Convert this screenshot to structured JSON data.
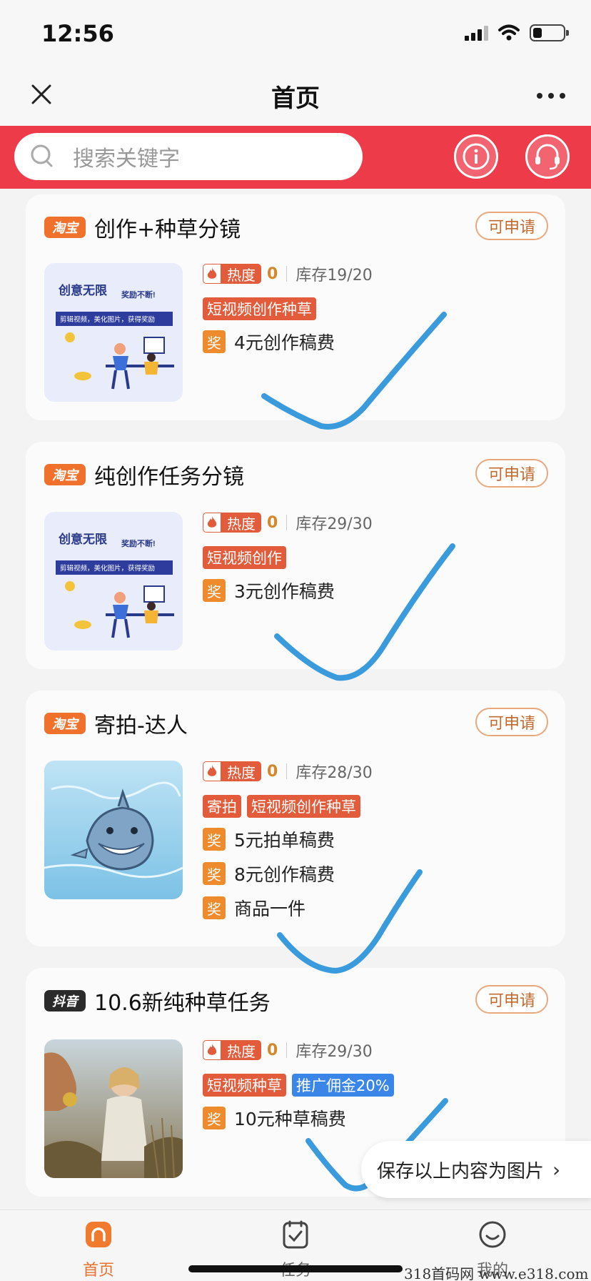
{
  "status_bar": {
    "time": "12:56"
  },
  "nav": {
    "title": "首页"
  },
  "search": {
    "placeholder": "搜索关键字"
  },
  "cards": [
    {
      "platform": "淘宝",
      "title": "创作+种草分镜",
      "apply": "可申请",
      "heat_label": "热度",
      "heat_value": "0",
      "stock": "库存19/20",
      "tags": [
        "短视频创作种草"
      ],
      "rewards": [
        {
          "badge": "奖",
          "text": "4元创作稿费"
        }
      ],
      "thumb": {
        "headline": "创意无限",
        "sub": "奖励不断!",
        "banner": "剪辑视频，美化图片，获得奖励"
      }
    },
    {
      "platform": "淘宝",
      "title": "纯创作任务分镜",
      "apply": "可申请",
      "heat_label": "热度",
      "heat_value": "0",
      "stock": "库存29/30",
      "tags": [
        "短视频创作"
      ],
      "rewards": [
        {
          "badge": "奖",
          "text": "3元创作稿费"
        }
      ],
      "thumb": {
        "headline": "创意无限",
        "sub": "奖励不断!",
        "banner": "剪辑视频，美化图片，获得奖励"
      }
    },
    {
      "platform": "淘宝",
      "title": "寄拍-达人",
      "apply": "可申请",
      "heat_label": "热度",
      "heat_value": "0",
      "stock": "库存28/30",
      "tags": [
        "寄拍",
        "短视频创作种草"
      ],
      "rewards": [
        {
          "badge": "奖",
          "text": "5元拍单稿费"
        },
        {
          "badge": "奖",
          "text": "8元创作稿费"
        },
        {
          "badge": "奖",
          "text": "商品一件"
        }
      ]
    },
    {
      "platform": "抖音",
      "title": "10.6新纯种草任务",
      "apply": "可申请",
      "heat_label": "热度",
      "heat_value": "0",
      "stock": "库存29/30",
      "tags": [
        "短视频种草",
        "推广佣金20%"
      ],
      "rewards": [
        {
          "badge": "奖",
          "text": "10元种草稿费"
        }
      ]
    }
  ],
  "save_pill": {
    "label": "保存以上内容为图片",
    "arrow": "›"
  },
  "tabs": [
    {
      "label": "首页",
      "icon": "home-icon",
      "active": true
    },
    {
      "label": "任务",
      "icon": "task-icon",
      "active": false
    },
    {
      "label": "我的",
      "icon": "profile-icon",
      "active": false
    }
  ],
  "watermark": "318首码网 www.e318.com",
  "colors": {
    "header_red": "#ee3b49",
    "accent_orange": "#e9702e",
    "tag_red": "#e25b3a",
    "tag_blue": "#3a86e8",
    "check_blue": "#3a9bdc"
  }
}
